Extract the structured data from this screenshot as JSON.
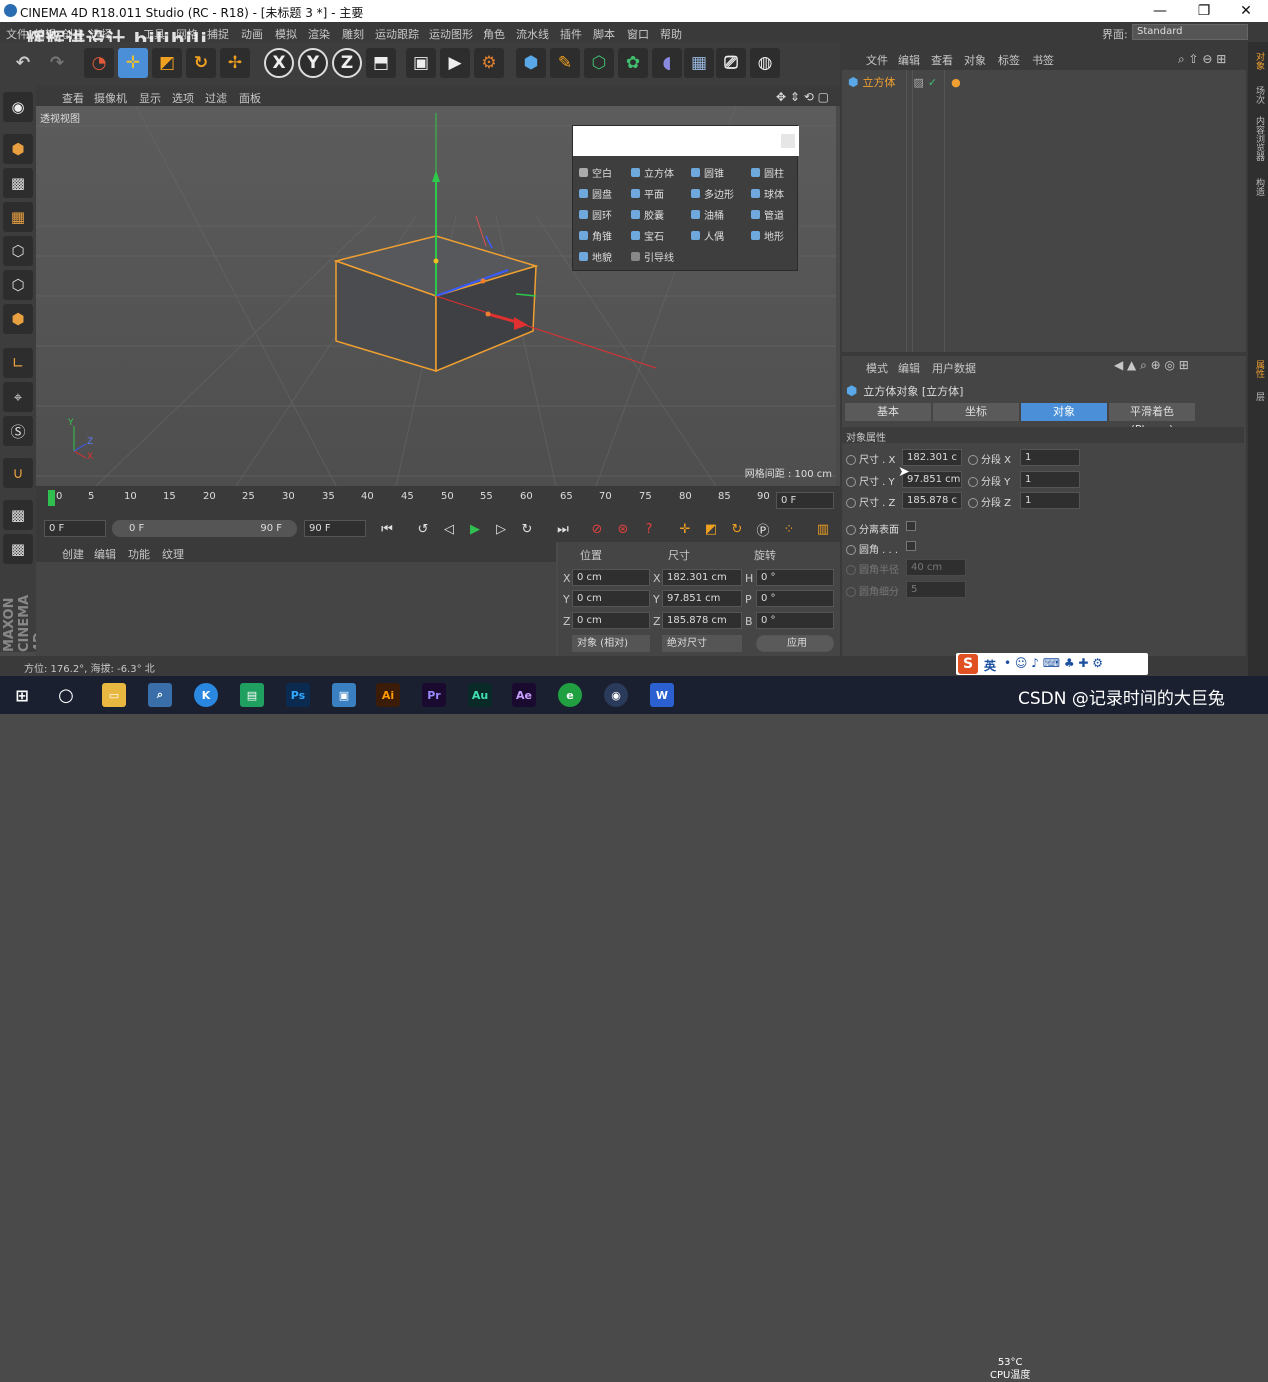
{
  "window": {
    "title": "CINEMA 4D R18.011 Studio (RC - R18) - [未标题 3 *] - 主要",
    "minimize": "—",
    "restore": "❐",
    "close": "✕"
  },
  "watermark": "辉辉讲设计 bilibili",
  "menubar": {
    "items": [
      "文件",
      "编辑",
      "创建",
      "选择",
      "工具",
      "网格",
      "捕捉",
      "动画",
      "模拟",
      "渲染",
      "雕刻",
      "运动跟踪",
      "运动图形",
      "角色",
      "流水线",
      "插件",
      "脚本",
      "窗口",
      "帮助"
    ],
    "layout_label": "界面:",
    "layout_value": "Standard"
  },
  "toolbar": {
    "x_label": "X",
    "y_label": "Y",
    "z_label": "Z"
  },
  "viewport": {
    "menu": [
      "查看",
      "摄像机",
      "显示",
      "选项",
      "过滤",
      "面板"
    ],
    "view_label": "透视视图",
    "grid_spacing": "网格间距 : 100 cm",
    "axis_y": "Y",
    "axis_z": "Z",
    "axis_x": "X"
  },
  "primitive_popup": {
    "items": [
      "空白",
      "立方体",
      "圆锥",
      "圆柱",
      "圆盘",
      "平面",
      "多边形",
      "球体",
      "圆环",
      "胶囊",
      "油桶",
      "管道",
      "角锥",
      "宝石",
      "人偶",
      "地形",
      "地貌",
      "引导线"
    ]
  },
  "timeline": {
    "ticks": [
      "0",
      "5",
      "10",
      "15",
      "20",
      "25",
      "30",
      "35",
      "40",
      "45",
      "50",
      "55",
      "60",
      "65",
      "70",
      "75",
      "80",
      "85",
      "90"
    ],
    "current_frame": "0 F"
  },
  "transport": {
    "start": "0 F",
    "range_start": "0 F",
    "range_end": "90 F",
    "end": "90 F"
  },
  "material_panel": {
    "menu": [
      "创建",
      "编辑",
      "功能",
      "纹理"
    ]
  },
  "coordinates": {
    "headers": [
      "位置",
      "尺寸",
      "旋转"
    ],
    "rows": [
      {
        "axis": "X",
        "pos": "0 cm",
        "size_axis": "X",
        "size": "182.301 cm",
        "rot_axis": "H",
        "rot": "0 °"
      },
      {
        "axis": "Y",
        "pos": "0 cm",
        "size_axis": "Y",
        "size": "97.851 cm",
        "rot_axis": "P",
        "rot": "0 °"
      },
      {
        "axis": "Z",
        "pos": "0 cm",
        "size_axis": "Z",
        "size": "185.878 cm",
        "rot_axis": "B",
        "rot": "0 °"
      }
    ],
    "mode": "对象 (相对)",
    "size_mode": "绝对尺寸",
    "apply": "应用"
  },
  "status": "方位: 176.2°, 海拔: -6.3° 北",
  "object_manager": {
    "menu": [
      "文件",
      "编辑",
      "查看",
      "对象",
      "标签",
      "书签"
    ],
    "objects": [
      {
        "name": "立方体"
      }
    ]
  },
  "attribute_manager": {
    "menu": [
      "模式",
      "编辑",
      "用户数据"
    ],
    "object_title": "立方体对象 [立方体]",
    "tabs": [
      "基本",
      "坐标",
      "对象",
      "平滑着色(Phong)"
    ],
    "active_tab": "对象",
    "section": "对象属性",
    "size_x_label": "尺寸 . X",
    "size_x": "182.301 c",
    "size_y_label": "尺寸 . Y",
    "size_y": "97.851 cm",
    "size_z_label": "尺寸 . Z",
    "size_z": "185.878 c",
    "seg_x_label": "分段 X",
    "seg_x": "1",
    "seg_y_label": "分段 Y",
    "seg_y": "1",
    "seg_z_label": "分段 Z",
    "seg_z": "1",
    "separate_surfaces": "分离表面",
    "fillet": "圆角 . . .",
    "fillet_radius_label": "圆角半径",
    "fillet_radius": "40 cm",
    "fillet_sub_label": "圆角细分",
    "fillet_sub": "5"
  },
  "side_tabs": [
    "对象",
    "场次",
    "内容浏览器",
    "构造",
    "属性",
    "层"
  ],
  "maxon_logo": "MAXON CINEMA 4D",
  "ime": {
    "lang": "英"
  },
  "system": {
    "temp": "53°C",
    "temp_label": "CPU温度"
  },
  "overlay_text": "CSDN @记录时间的大巨兔",
  "colors": {
    "accent_blue": "#4a8fd8",
    "selection_orange": "#e8a040"
  }
}
